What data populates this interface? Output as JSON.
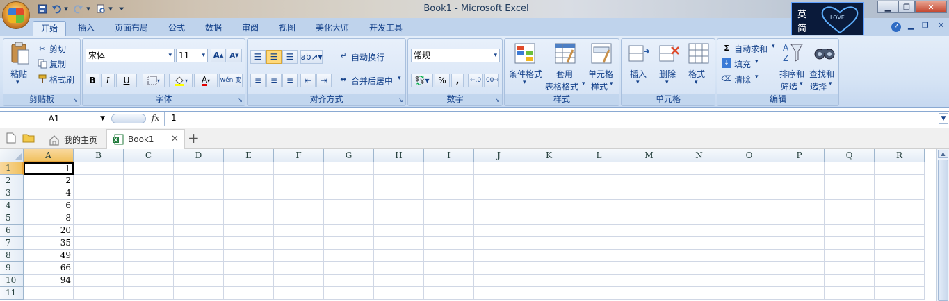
{
  "window": {
    "title": "Book1 - Microsoft Excel"
  },
  "ime": {
    "lang1": "英",
    "lang2": "简",
    "badge": "LOVE"
  },
  "tabs": [
    "开始",
    "插入",
    "页面布局",
    "公式",
    "数据",
    "审阅",
    "视图",
    "美化大师",
    "开发工具"
  ],
  "clipboard": {
    "paste": "粘贴",
    "cut": "剪切",
    "copy": "复制",
    "format_painter": "格式刷",
    "title": "剪贴板"
  },
  "font": {
    "name": "宋体",
    "size": "11",
    "title": "字体",
    "bold": "B",
    "italic": "I",
    "underline": "U",
    "color_a": "A",
    "phonetic": "wén 变"
  },
  "alignment": {
    "wrap": "自动换行",
    "merge": "合并后居中",
    "title": "对齐方式"
  },
  "number": {
    "format": "常规",
    "percent": "%",
    "comma": ",",
    "title": "数字"
  },
  "styles": {
    "conditional": "条件格式",
    "table_line1": "套用",
    "table_line2": "表格格式",
    "cell_line1": "单元格",
    "cell_line2": "样式",
    "title": "样式"
  },
  "cells": {
    "insert": "插入",
    "delete": "删除",
    "format": "格式",
    "title": "单元格"
  },
  "editing": {
    "autosum": "自动求和",
    "fill": "填充",
    "clear": "清除",
    "sort_line1": "排序和",
    "sort_line2": "筛选",
    "find_line1": "查找和",
    "find_line2": "选择",
    "title": "编辑"
  },
  "formula_bar": {
    "name_box": "A1",
    "fx": "fx",
    "content": "1"
  },
  "doc_tabs": {
    "home": "我的主页",
    "book": "Book1",
    "close": "✕",
    "new": "+"
  },
  "sheet": {
    "columns": [
      "A",
      "B",
      "C",
      "D",
      "E",
      "F",
      "G",
      "H",
      "I",
      "J",
      "K",
      "L",
      "M",
      "N",
      "O",
      "P",
      "Q",
      "R"
    ],
    "rows": [
      "1",
      "2",
      "3",
      "4",
      "5",
      "6",
      "7",
      "8",
      "9",
      "10",
      "11"
    ],
    "col_a_values": [
      "1",
      "2",
      "4",
      "6",
      "8",
      "20",
      "35",
      "49",
      "66",
      "94",
      ""
    ]
  }
}
